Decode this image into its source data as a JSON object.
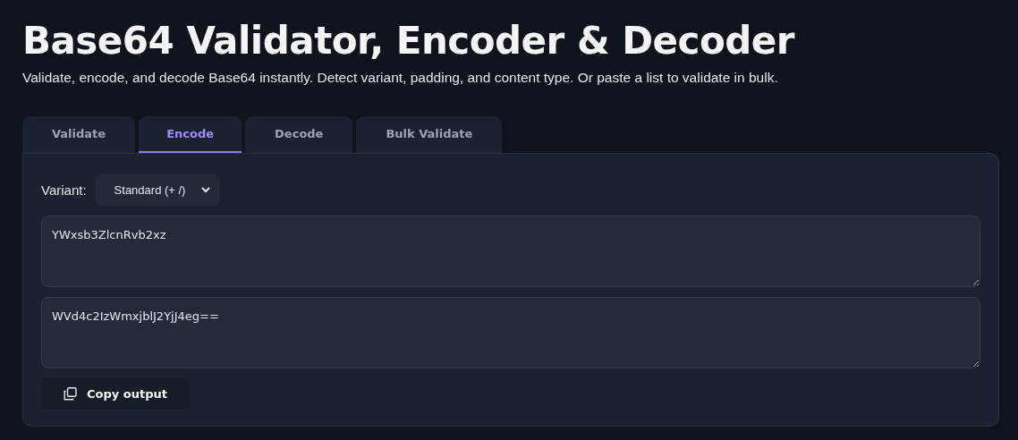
{
  "title": "Base64 Validator, Encoder & Decoder",
  "subtitle": "Validate, encode, and decode Base64 instantly. Detect variant, padding, and content type. Or paste a list to validate in bulk.",
  "tabs": [
    {
      "label": "Validate",
      "selected": false
    },
    {
      "label": "Encode",
      "selected": true
    },
    {
      "label": "Decode",
      "selected": false
    },
    {
      "label": "Bulk Validate",
      "selected": false
    }
  ],
  "variant": {
    "label": "Variant:",
    "value": "Standard (+ /)"
  },
  "input": {
    "value": "YWxsb3ZlcnRvb2xz"
  },
  "output": {
    "value": "WVd4c2IzWmxjblJ2YjJ4eg=="
  },
  "copy_button": {
    "label": "Copy output"
  }
}
